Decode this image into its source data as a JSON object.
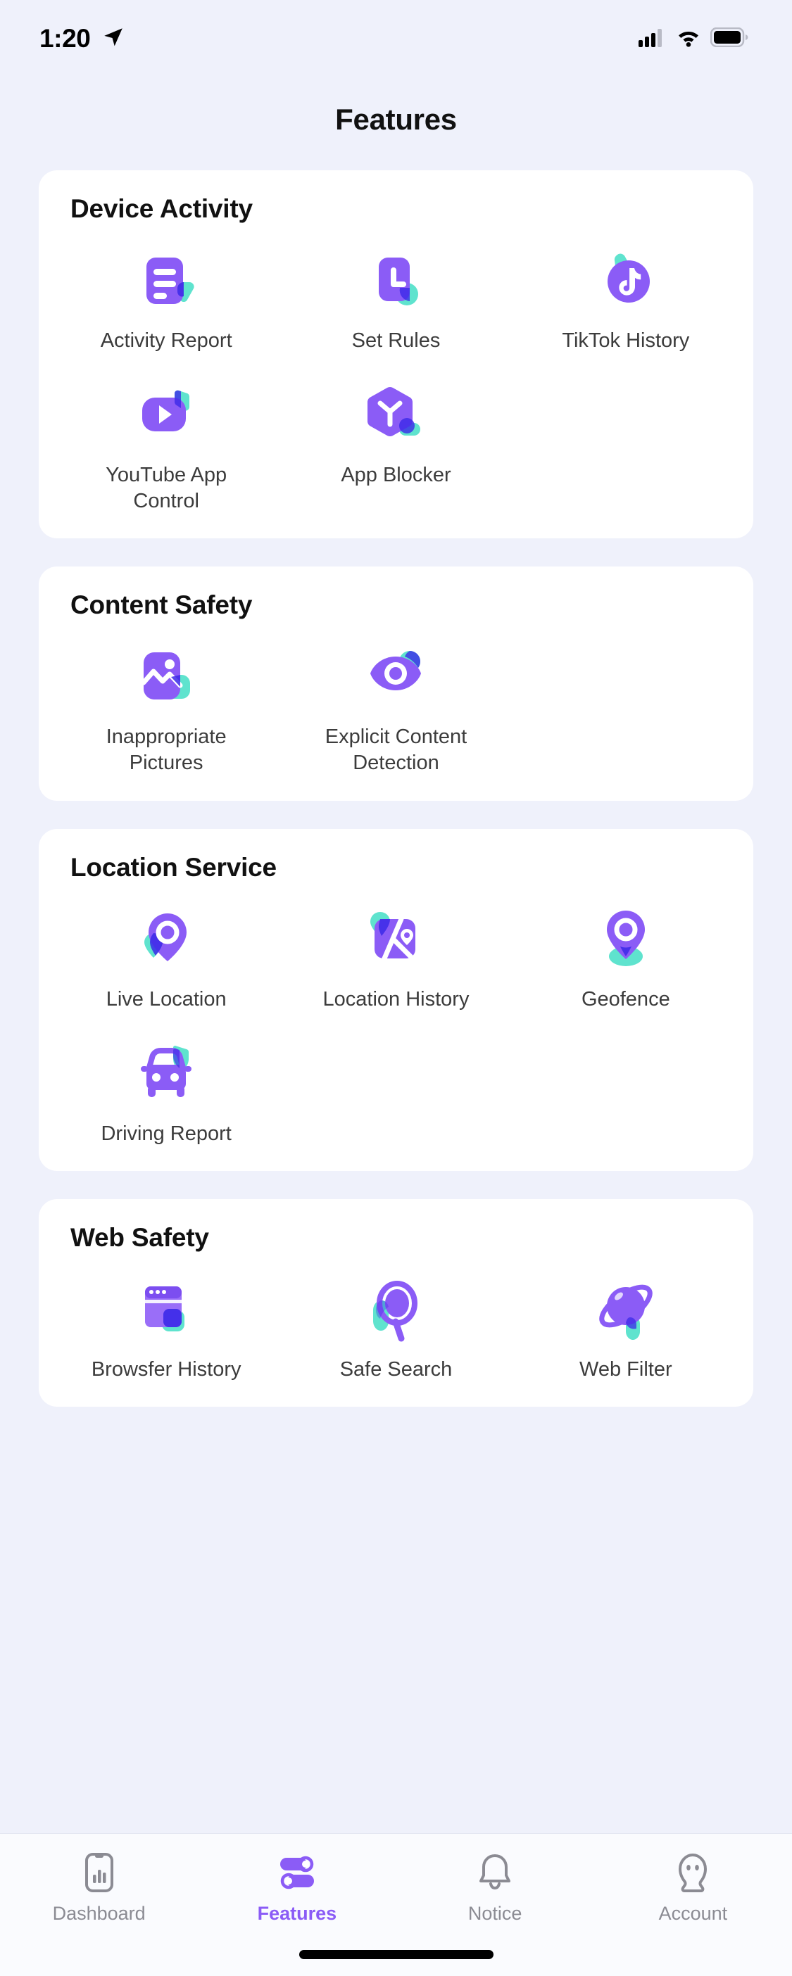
{
  "status_bar": {
    "time": "1:20",
    "location_icon": "location-arrow-icon",
    "signal_icon": "cellular-signal-icon",
    "wifi_icon": "wifi-icon",
    "battery_icon": "battery-full-icon"
  },
  "header": {
    "title": "Features"
  },
  "colors": {
    "background": "#eff1fb",
    "card": "#ffffff",
    "purple": "#8b5cf6",
    "purple_deep": "#3b29e8",
    "teal": "#5fe3ce",
    "label": "#3c3c3c",
    "tab_inactive": "#8b8b93"
  },
  "sections": [
    {
      "title": "Device Activity",
      "items": [
        {
          "label": "Activity Report",
          "icon": "activity-report-icon"
        },
        {
          "label": "Set Rules",
          "icon": "set-rules-clock-icon"
        },
        {
          "label": "TikTok History",
          "icon": "tiktok-history-icon"
        },
        {
          "label": "YouTube App Control",
          "icon": "youtube-app-control-icon"
        },
        {
          "label": "App Blocker",
          "icon": "app-blocker-icon"
        }
      ]
    },
    {
      "title": "Content Safety",
      "items": [
        {
          "label": "Inappropriate Pictures",
          "icon": "inappropriate-pictures-icon"
        },
        {
          "label": "Explicit Content Detection",
          "icon": "explicit-content-detection-eye-icon"
        }
      ]
    },
    {
      "title": "Location Service",
      "items": [
        {
          "label": "Live Location",
          "icon": "live-location-pin-icon"
        },
        {
          "label": "Location History",
          "icon": "location-history-map-icon"
        },
        {
          "label": "Geofence",
          "icon": "geofence-pin-icon"
        },
        {
          "label": "Driving Report",
          "icon": "driving-report-car-icon"
        }
      ]
    },
    {
      "title": "Web Safety",
      "items": [
        {
          "label": "Browsfer History",
          "icon": "browser-history-icon"
        },
        {
          "label": "Safe Search",
          "icon": "safe-search-magnifier-icon"
        },
        {
          "label": "Web Filter",
          "icon": "web-filter-planet-icon"
        }
      ]
    }
  ],
  "tabbar": {
    "active": "Features",
    "tabs": [
      {
        "label": "Dashboard",
        "icon": "dashboard-phone-chart-icon"
      },
      {
        "label": "Features",
        "icon": "features-sliders-icon"
      },
      {
        "label": "Notice",
        "icon": "notice-bell-icon"
      },
      {
        "label": "Account",
        "icon": "account-person-icon"
      }
    ]
  }
}
